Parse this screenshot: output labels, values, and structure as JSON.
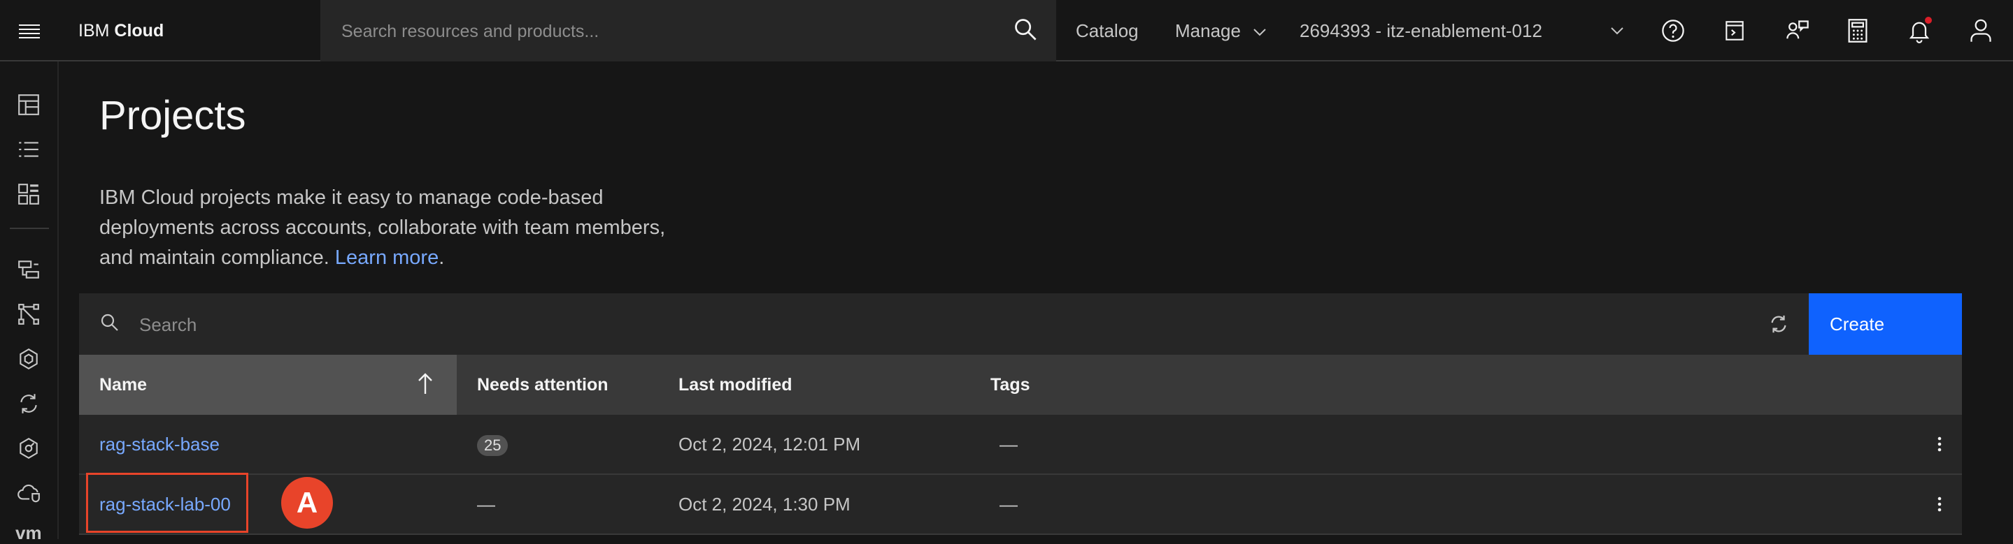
{
  "header": {
    "brand_prefix": "IBM",
    "brand_name": "Cloud",
    "search_placeholder": "Search resources and products...",
    "catalog": "Catalog",
    "manage": "Manage",
    "account": "2694393 - itz-enablement-012",
    "icons": [
      "help-icon",
      "cloud-shell-icon",
      "switcher-icon",
      "cost-estimator-icon",
      "notification-icon",
      "user-avatar-icon"
    ]
  },
  "rail": {
    "icons": [
      "dashboard-icon",
      "resource-list-icon",
      "catalog-icon",
      "projects-icon",
      "schematics-icon",
      "hexagon-icon",
      "automation-icon",
      "security-icon",
      "cloud-shield-icon"
    ],
    "bottom_text": "vm"
  },
  "page": {
    "title": "Projects",
    "description": "IBM Cloud projects make it easy to manage code-based deployments across accounts, collaborate with team members, and maintain compliance.",
    "learn_more": "Learn more",
    "period": "."
  },
  "toolbar": {
    "search_placeholder": "Search",
    "create_label": "Create"
  },
  "table": {
    "columns": [
      "Name",
      "Needs attention",
      "Last modified",
      "Tags"
    ],
    "rows": [
      {
        "name": "rag-stack-base",
        "needs_attention": "25",
        "last_modified": "Oct 2, 2024, 12:01 PM",
        "tags": "—"
      },
      {
        "name": "rag-stack-lab-00",
        "needs_attention": "—",
        "last_modified": "Oct 2, 2024, 1:30 PM",
        "tags": "—"
      }
    ]
  },
  "annotation": {
    "marker": "A",
    "color": "#e8442a"
  },
  "colors": {
    "accent": "#0f62fe",
    "link": "#78a9ff",
    "background": "#161616"
  }
}
